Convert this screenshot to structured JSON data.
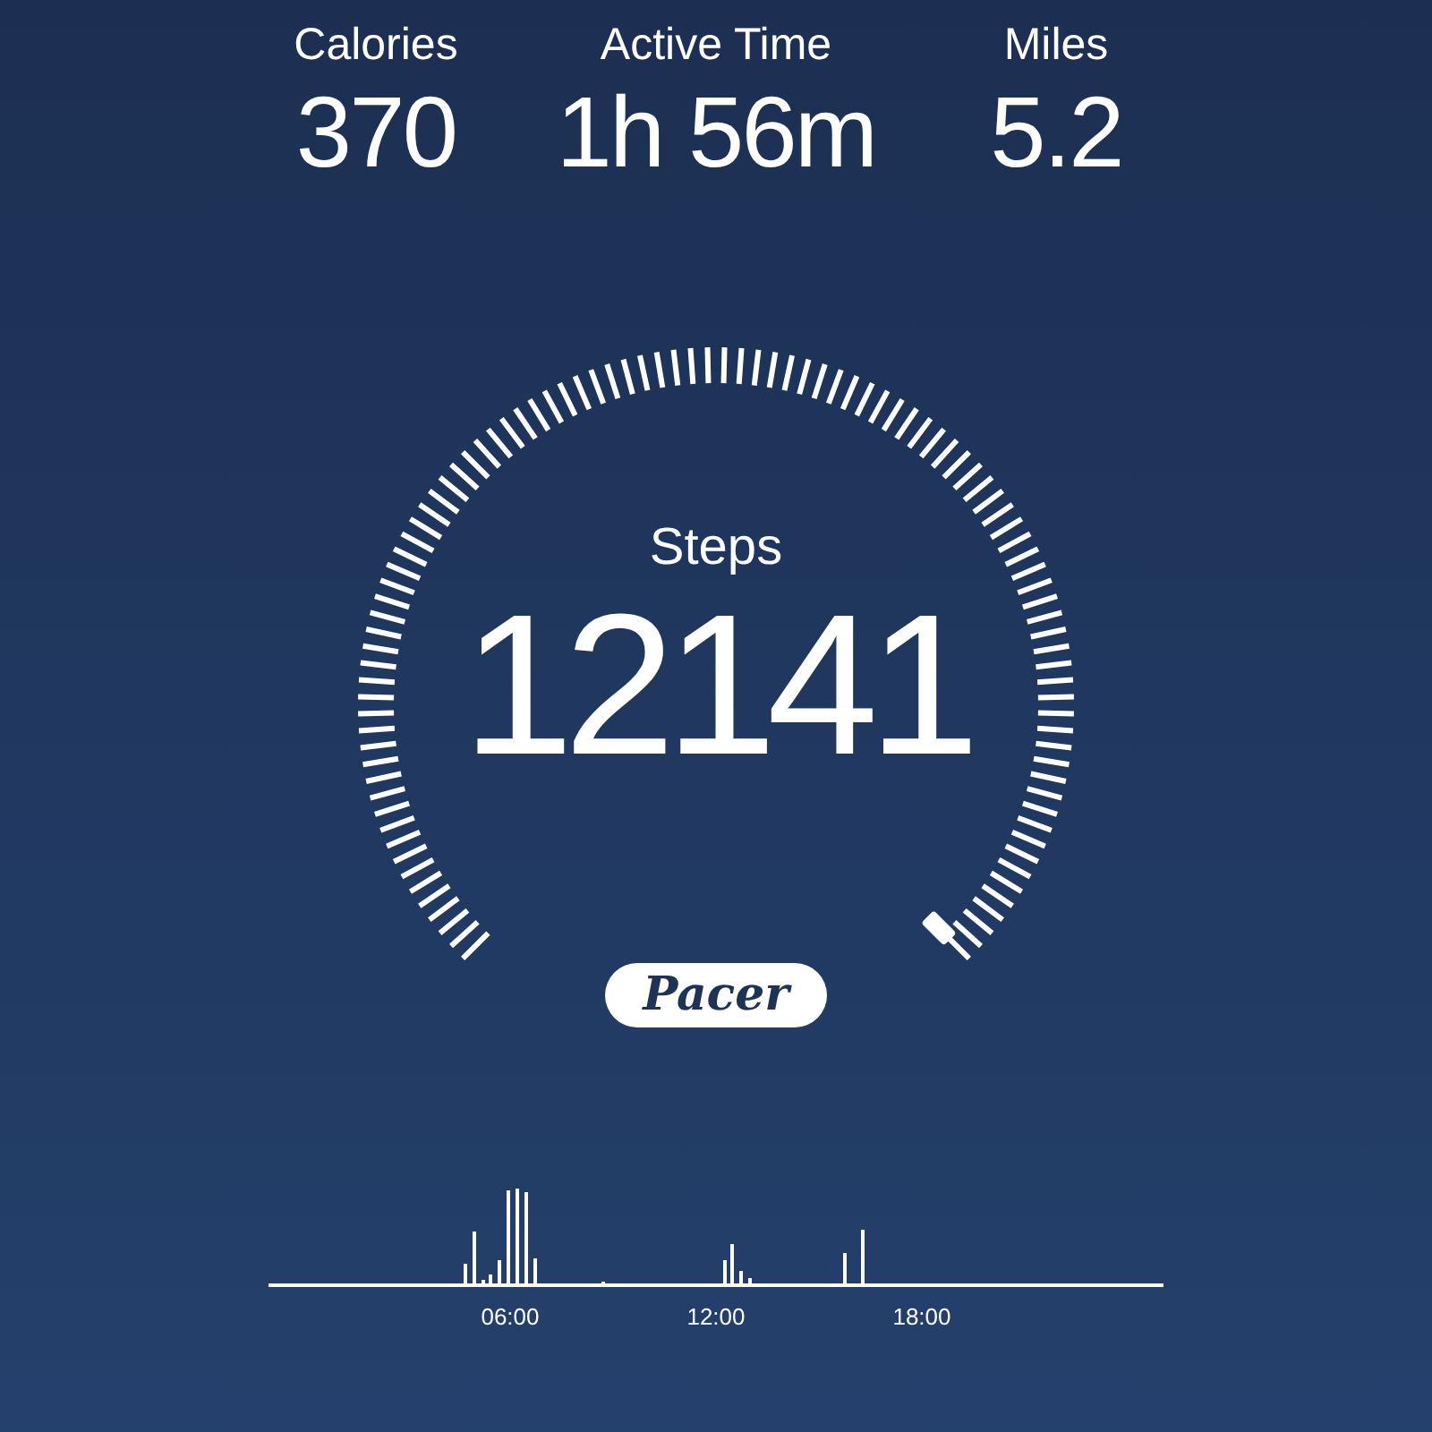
{
  "stats": [
    {
      "label": "Calories",
      "value": "370"
    },
    {
      "label": "Active Time",
      "value": "1h 56m"
    },
    {
      "label": "Miles",
      "value": "5.2"
    }
  ],
  "gauge": {
    "label": "Steps",
    "value": "12141"
  },
  "brand": "Pacer",
  "activity_chart": {
    "axis_labels": [
      "06:00",
      "12:00",
      "18:00"
    ]
  }
}
